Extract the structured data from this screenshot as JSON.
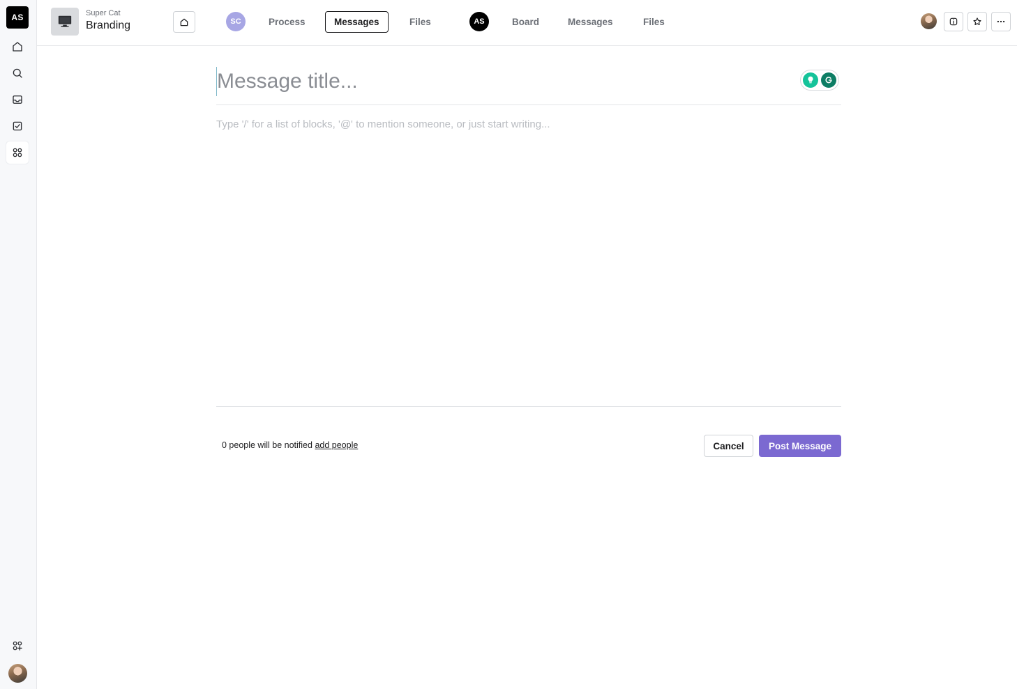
{
  "rail": {
    "workspace_initials": "AS",
    "items": [
      {
        "icon": "home-icon"
      },
      {
        "icon": "search-icon"
      },
      {
        "icon": "inbox-icon"
      },
      {
        "icon": "tasks-icon"
      },
      {
        "icon": "apps-icon",
        "active": true
      }
    ],
    "bottom": [
      {
        "icon": "add-apps-icon"
      },
      {
        "icon": "user-avatar"
      }
    ]
  },
  "header": {
    "org": "Super Cat",
    "project": "Branding",
    "group1": {
      "badge": "SC",
      "tabs": [
        {
          "label": "Process"
        },
        {
          "label": "Messages",
          "active": true
        },
        {
          "label": "Files"
        }
      ]
    },
    "group2": {
      "badge": "AS",
      "tabs": [
        {
          "label": "Board"
        },
        {
          "label": "Messages"
        },
        {
          "label": "Files"
        }
      ]
    },
    "right_icons": [
      "info-icon",
      "star-icon",
      "more-icon"
    ]
  },
  "editor": {
    "title_placeholder": "Message title...",
    "title_value": "",
    "body_placeholder": "Type '/' for a list of blocks, '@' to mention someone, or just start writing..."
  },
  "footer": {
    "notify_text": "0 people will be notified",
    "add_people": "add people",
    "cancel_label": "Cancel",
    "post_label": "Post Message"
  },
  "colors": {
    "accent": "#7b69d1",
    "badge_sc": "#a7a6e4",
    "grammarly": "#15c39a"
  }
}
